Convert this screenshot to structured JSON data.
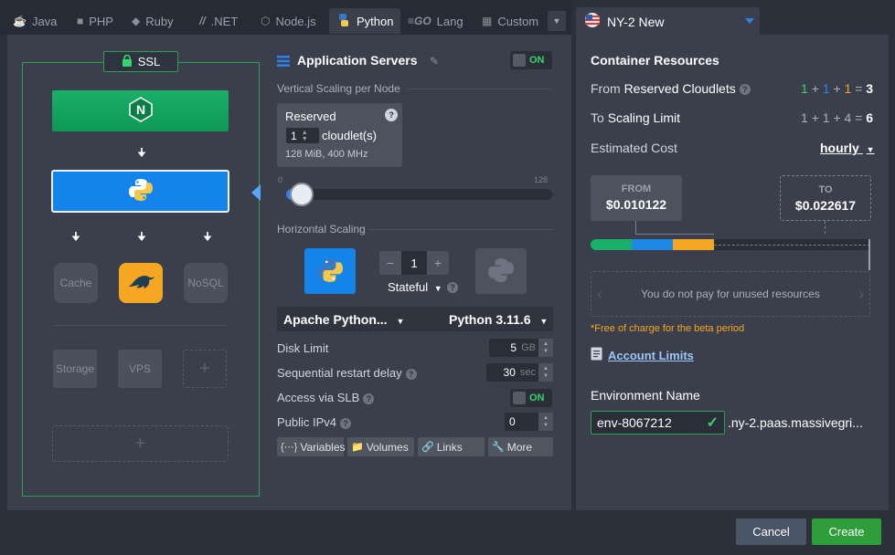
{
  "tabs": [
    {
      "label": "Java",
      "icon": "java-icon"
    },
    {
      "label": "PHP",
      "icon": "php-icon"
    },
    {
      "label": "Ruby",
      "icon": "ruby-icon"
    },
    {
      "label": ".NET",
      "icon": "dotnet-icon"
    },
    {
      "label": "Node.js",
      "icon": "nodejs-icon"
    },
    {
      "label": "Python",
      "icon": "python-icon",
      "active": true
    },
    {
      "label": "Lang",
      "icon": "go-icon"
    },
    {
      "label": "Custom",
      "icon": "custom-icon"
    }
  ],
  "region": {
    "label": "NY-2 New",
    "flag": "us-flag-icon"
  },
  "topology": {
    "ssl_label": "SSL",
    "nodes": {
      "cache": "Cache",
      "nosql": "NoSQL",
      "storage": "Storage",
      "vps": "VPS"
    }
  },
  "app_servers": {
    "title": "Application Servers",
    "toggle_label": "ON",
    "vertical_label": "Vertical Scaling per Node",
    "reserved_label": "Reserved",
    "reserved_value": "1",
    "reserved_unit": "cloudlet(s)",
    "reserved_spec": "128 MiB, 400 MHz",
    "slider_min": "0",
    "slider_max": "128",
    "horizontal_label": "Horizontal Scaling",
    "node_count": "1",
    "stateful_label": "Stateful",
    "server_select": "Apache Python...",
    "version_select": "Python 3.11.6",
    "disk_label": "Disk Limit",
    "disk_value": "5",
    "disk_unit": "GB",
    "restart_label": "Sequential restart delay",
    "restart_value": "30",
    "restart_unit": "sec",
    "slb_label": "Access via SLB",
    "slb_toggle": "ON",
    "ipv4_label": "Public IPv4",
    "ipv4_value": "0",
    "buttons": {
      "variables": "Variables",
      "volumes": "Volumes",
      "links": "Links",
      "more": "More"
    }
  },
  "resources": {
    "title": "Container Resources",
    "reserved_label_from": "From",
    "reserved_label": "Reserved Cloudlets",
    "reserved_parts": [
      "1",
      "1",
      "1"
    ],
    "reserved_total": "3",
    "scaling_label_to": "To",
    "scaling_label": "Scaling Limit",
    "scaling_parts": [
      "1",
      "1",
      "4"
    ],
    "scaling_total": "6",
    "cost_label": "Estimated Cost",
    "cost_period": "hourly",
    "from_label": "FROM",
    "from_value": "$0.010122",
    "to_label": "TO",
    "to_value": "$0.022617",
    "unused_text": "You do not pay for unused resources",
    "beta_note": "*Free of charge for the beta period",
    "account_limits": "Account Limits",
    "env_name_label": "Environment Name",
    "env_name_value": "env-8067212",
    "env_domain": ".ny-2.paas.massivegri..."
  },
  "colors": {
    "green": "#19b06a",
    "blue": "#1584ea",
    "orange": "#f5a623",
    "accent_green": "#2e9e3a"
  },
  "footer": {
    "cancel": "Cancel",
    "create": "Create"
  }
}
